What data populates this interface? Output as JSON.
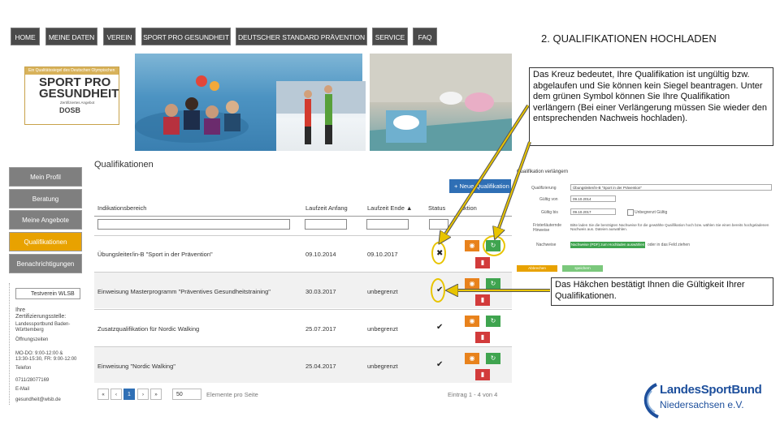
{
  "nav": [
    "HOME",
    "MEINE DATEN",
    "VEREIN",
    "SPORT PRO GESUNDHEIT",
    "DEUTSCHER STANDARD PRÄVENTION",
    "SERVICE",
    "FAQ"
  ],
  "logo": {
    "top": "Ein Qualitätssiegel des Deutschen Olympischen Sportbundes",
    "title_1": "SPORT PRO",
    "title_2": "GESUNDHEIT",
    "sub": "Zertifiziertes Angebot",
    "org": "DOSB"
  },
  "sidebar": {
    "items": [
      "Mein Profil",
      "Beratung",
      "Meine Angebote",
      "Qualifikationen",
      "Benachrichtigungen"
    ],
    "active_index": 3,
    "select_value": "Testverein WLSB",
    "contact": [
      "Ihre",
      "Zertifizierungsstelle:",
      "Landessportbund Baden-",
      "Württemberg",
      "Öffnungszeiten",
      "MO-DO: 9:00-12:00 &",
      "13:30-15:30, FR: 9:00-12:00",
      "Telefon",
      "0711/28077169",
      "E-Mail",
      "gesundheit@wlsb.de"
    ]
  },
  "main": {
    "title": "Qualifikationen",
    "new_button": "+ Neue Qualifikation",
    "columns": [
      "Indikationsbereich",
      "Laufzeit Anfang",
      "Laufzeit Ende ▲",
      "Status",
      "Aktion"
    ],
    "rows": [
      {
        "name": "Übungsleiter/in-B \"Sport in der Prävention\"",
        "start": "09.10.2014",
        "end": "09.10.2017",
        "status": "✖"
      },
      {
        "name": "Einweisung Masterprogramm \"Präventives Gesundheitstraining\"",
        "start": "30.03.2017",
        "end": "unbegrenzt",
        "status": "✔"
      },
      {
        "name": "Zusatzqualifikation für Nordic Walking",
        "start": "25.07.2017",
        "end": "unbegrenzt",
        "status": "✔"
      },
      {
        "name": "Einweisung \"Nordic Walking\"",
        "start": "25.04.2017",
        "end": "unbegrenzt",
        "status": "✔"
      }
    ],
    "pager": {
      "first": "«",
      "prev": "‹",
      "current": "1",
      "next": "›",
      "last": "»",
      "per_page": "50",
      "per_page_label": "Elemente pro Seite",
      "info": "Eintrag 1 - 4 von 4"
    }
  },
  "panel": {
    "title": "Qualifikation verlängern",
    "labels": [
      "Qualifizierung",
      "Gültig von",
      "Gültig bis",
      "Fristerläuternde Hinweise",
      "Nachweise"
    ],
    "qual_value": "Übungsleiter/in-B \"Sport in der Prävention\"",
    "from_value": "09.10.2014",
    "to_value": "09.10.2017",
    "unlimited_label": "Unbegrenzt Gültig",
    "hint": "Bitte laden Sie die benötigten Nachweise für die gewählte Qualifikation hoch bzw. wählen Sie einen bereits hochgeladenen Nachweis aus. Dateien auswählen.",
    "upload_button": "Nachweise (PDF) zum Hochladen auswählen",
    "upload_hint": "oder in das Feld ziehen",
    "cancel": "Abbrechen",
    "save": "speichern"
  },
  "annotations": {
    "heading": "2. QUALIFIKATIONEN HOCHLADEN",
    "note_1": "Das Kreuz bedeutet, Ihre Qualifikation ist ungültig bzw. abgelaufen und Sie können kein Siegel beantragen. Unter dem grünen Symbol können Sie Ihre Qualifikation verlängern (Bei einer Verlängerung müssen Sie wieder den entsprechenden Nachweis hochladen).",
    "note_2": "Das Häkchen bestätigt Ihnen die Gültigkeit Ihrer Qualifikationen."
  },
  "footer_logo": {
    "line_1": "LandesSportBund",
    "line_2": "Niedersachsen e.V."
  },
  "colors": {
    "nav": "#4a4a4a",
    "active": "#e8a200",
    "primary": "#2f6fb5",
    "orange": "#e8821c",
    "green": "#3fa44f",
    "red": "#d23b3b",
    "highlight": "#e8c400"
  }
}
